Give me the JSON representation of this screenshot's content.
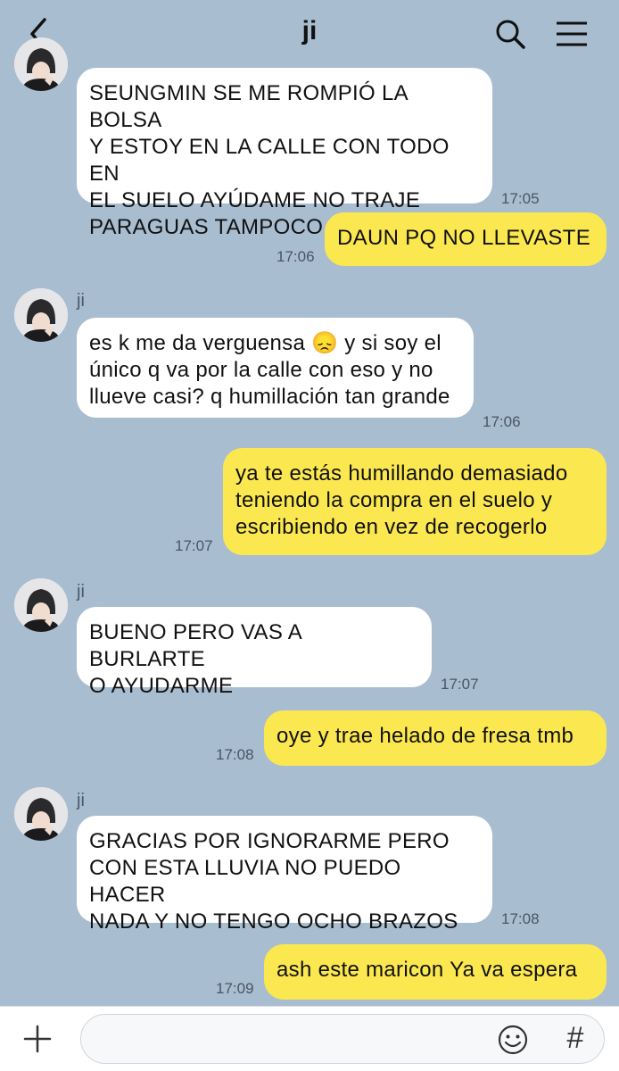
{
  "header": {
    "title": "ji"
  },
  "messages": [
    {
      "direction": "in",
      "sender": "",
      "lines": [
        "SEUNGMIN SE ME ROMPIÓ LA BOLSA",
        "Y ESTOY EN LA CALLE CON TODO EN",
        "EL SUELO AYÚDAME NO TRAJE",
        "PARAGUAS TAMPOCO TENGO ASMA"
      ],
      "time": "17:05"
    },
    {
      "direction": "out",
      "lines": [
        "DAUN PQ NO LLEVASTE"
      ],
      "time": "17:06"
    },
    {
      "direction": "in",
      "sender": "ji",
      "lines": [
        "es k me da verguensa 😞 y si soy el",
        "único q va por la calle con eso y no",
        "llueve casi? q humillación tan grande"
      ],
      "time": "17:06"
    },
    {
      "direction": "out",
      "lines": [
        "ya te estás humillando demasiado",
        "teniendo la compra en el suelo y",
        "escribiendo en vez de recogerlo"
      ],
      "time": "17:07"
    },
    {
      "direction": "in",
      "sender": "ji",
      "lines": [
        "BUENO PERO VAS A BURLARTE",
        "O AYUDARME"
      ],
      "time": "17:07"
    },
    {
      "direction": "out",
      "lines": [
        "oye y trae helado de fresa tmb"
      ],
      "time": "17:08"
    },
    {
      "direction": "in",
      "sender": "ji",
      "lines": [
        "GRACIAS POR IGNORARME PERO",
        "CON ESTA LLUVIA NO PUEDO HACER",
        "NADA Y NO TENGO OCHO BRAZOS"
      ],
      "time": "17:08"
    },
    {
      "direction": "out",
      "lines": [
        "ash este maricon Ya va espera"
      ],
      "time": "17:09"
    }
  ],
  "composer": {
    "placeholder": ""
  },
  "icons": {
    "back": "chevron-left-icon",
    "search": "search-icon",
    "menu": "hamburger-menu-icon",
    "attach": "plus-icon",
    "emoji": "emoji-icon",
    "hashtag": "hashtag-icon"
  },
  "colors": {
    "background": "#a9bdd1",
    "incoming_bubble": "#ffffff",
    "outgoing_bubble": "#fbe850"
  }
}
